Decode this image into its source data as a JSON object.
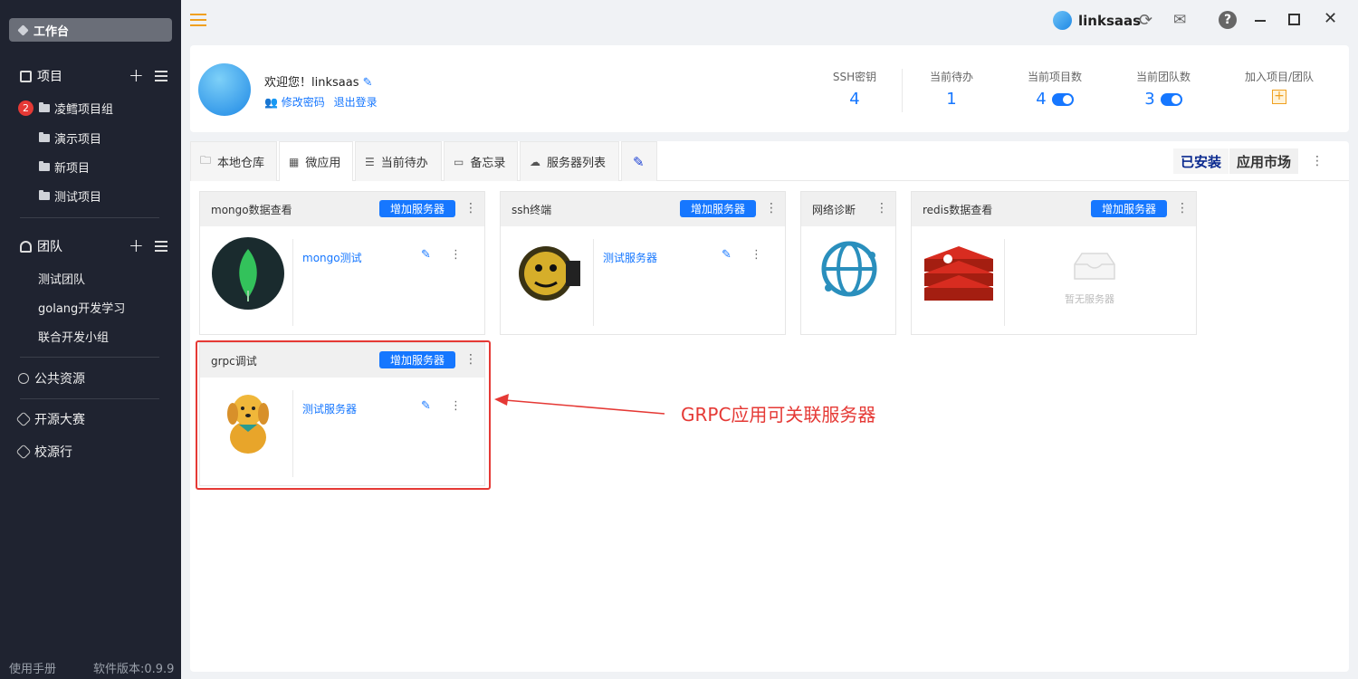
{
  "sidebar": {
    "workbench": "工作台",
    "projects_title": "项目",
    "project_items": [
      {
        "badge": "2",
        "label": "凌鳕项目组"
      },
      {
        "label": "演示项目"
      },
      {
        "label": "新项目"
      },
      {
        "label": "测试项目"
      }
    ],
    "teams_title": "团队",
    "team_items": [
      "测试团队",
      "golang开发学习",
      "联合开发小组"
    ],
    "public_resources": "公共资源",
    "open_source_contest": "开源大赛",
    "school_source": "校源行",
    "manual": "使用手册",
    "version": "软件版本:0.9.9"
  },
  "topbar": {
    "brand": "linksaas"
  },
  "user": {
    "welcome": "欢迎您！linksaas",
    "change_password": "修改密码",
    "logout": "退出登录"
  },
  "stats": [
    {
      "label": "SSH密钥",
      "value": "4"
    },
    {
      "label": "当前待办",
      "value": "1"
    },
    {
      "label": "当前项目数",
      "value": "4"
    },
    {
      "label": "当前团队数",
      "value": "3"
    },
    {
      "label": "加入项目/团队",
      "value": "+"
    }
  ],
  "tabs": [
    "本地仓库",
    "微应用",
    "当前待办",
    "备忘录",
    "服务器列表"
  ],
  "segments": {
    "installed": "已安装",
    "market": "应用市场"
  },
  "apps": {
    "add_server_label": "增加服务器",
    "mongo": {
      "title": "mongo数据查看",
      "server": "mongo测试"
    },
    "ssh": {
      "title": "ssh终端",
      "server": "测试服务器"
    },
    "net": {
      "title": "网络诊断"
    },
    "redis": {
      "title": "redis数据查看",
      "empty": "暂无服务器"
    },
    "grpc": {
      "title": "grpc调试",
      "server": "测试服务器"
    }
  },
  "annotation": "GRPC应用可关联服务器",
  "colors": {
    "accent": "#1677ff",
    "sidebar_bg": "#1f2330",
    "annotation": "#e53935"
  }
}
